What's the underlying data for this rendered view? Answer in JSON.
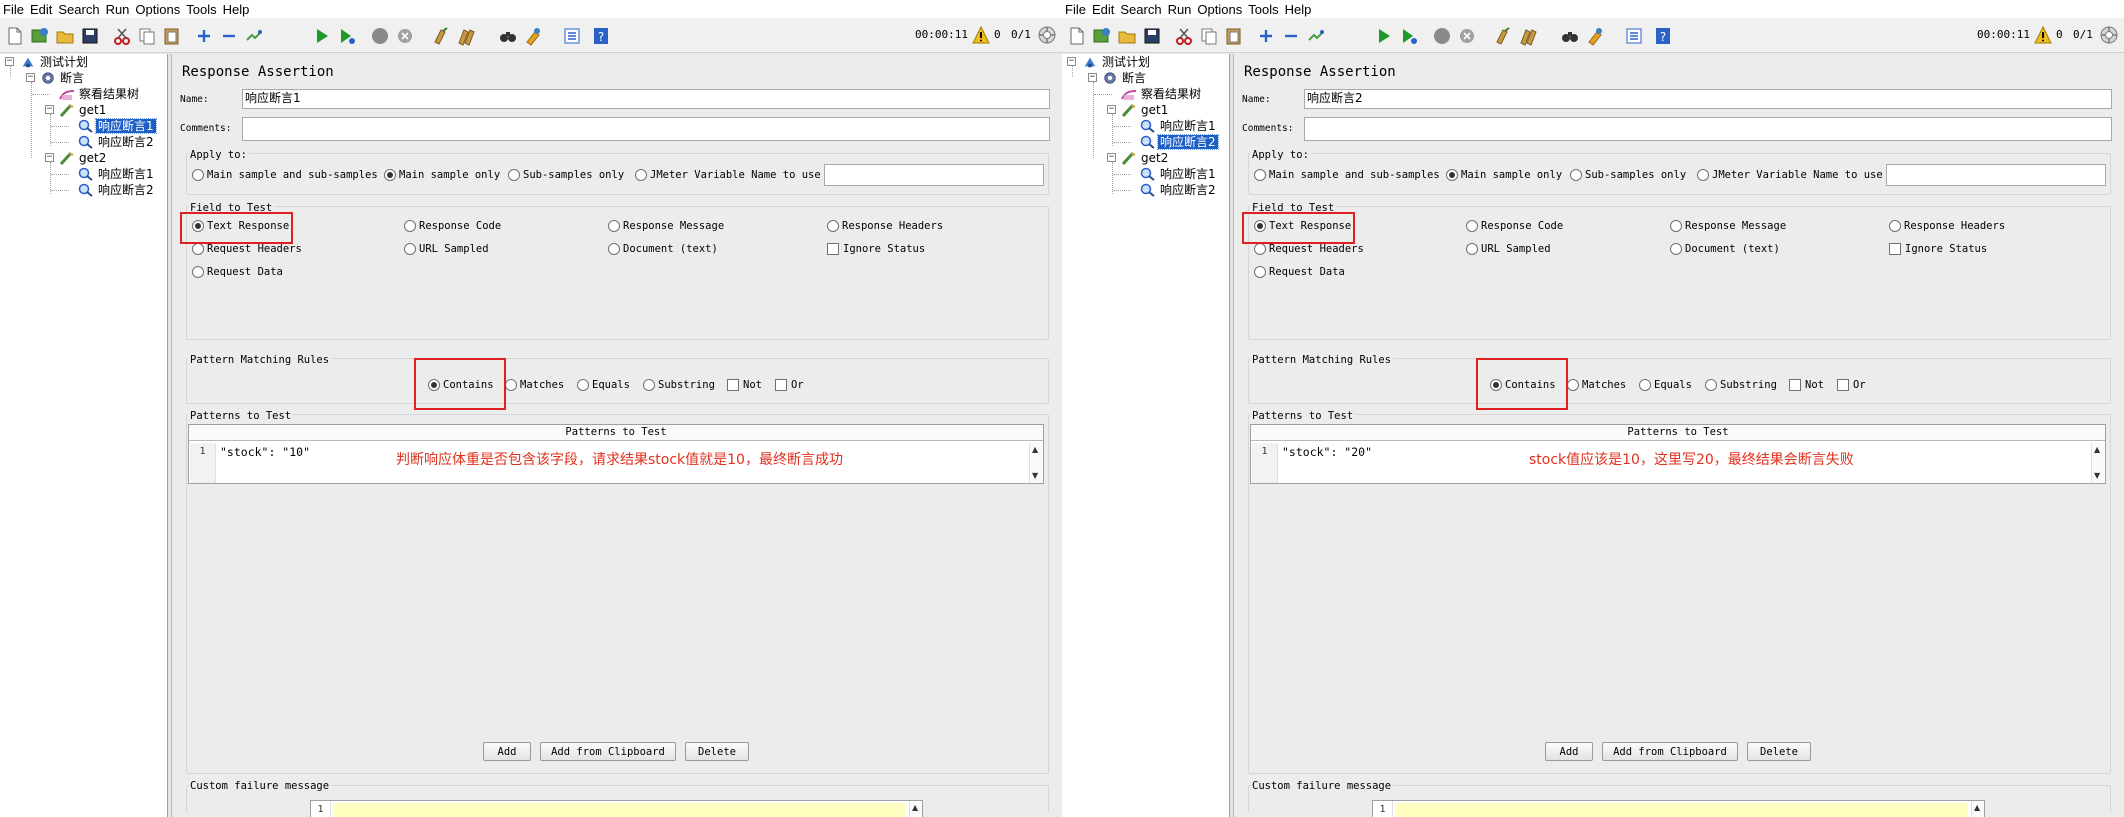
{
  "menu": [
    "File",
    "Edit",
    "Search",
    "Run",
    "Options",
    "Tools",
    "Help"
  ],
  "toolbar": {
    "timer": "00:00:11",
    "warn_count": "0",
    "thread_count": "0/1",
    "icons": [
      "new-icon",
      "templates-icon",
      "open-icon",
      "save-icon",
      "cut-icon",
      "copy-icon",
      "paste-icon",
      "expand-icon",
      "collapse-icon",
      "toggle-icon",
      "start-icon",
      "start-no-pause-icon",
      "stop-icon",
      "shutdown-icon",
      "clear-icon",
      "clear-all-icon",
      "search-icon",
      "reset-search-icon",
      "function-helper-icon",
      "help-icon"
    ]
  },
  "colors": {
    "annotation": "#e0301e",
    "selection": "#1c5ec4",
    "highlight": "#ffffc0"
  },
  "windows": [
    {
      "tree": {
        "plan": "测试计划",
        "group": "断言",
        "listener": "察看结果树",
        "get1": "get1",
        "get1_a1": "响应断言1",
        "get1_a2": "响应断言2",
        "get2": "get2",
        "get2_a1": "响应断言1",
        "get2_a2": "响应断言2",
        "selected": "get1_a1"
      },
      "form": {
        "title": "Response Assertion",
        "name_label": "Name:",
        "name_value": "响应断言1",
        "comments_label": "Comments:",
        "comments_value": "",
        "apply_to_label": "Apply to:",
        "apply_options": [
          "Main sample and sub-samples",
          "Main sample only",
          "Sub-samples only",
          "JMeter Variable Name to use"
        ],
        "apply_selected": 1,
        "jmeter_var_value": "",
        "field_label": "Field to Test",
        "fields": [
          "Text Response",
          "Response Code",
          "Response Message",
          "Response Headers",
          "Request Headers",
          "URL Sampled",
          "Document (text)",
          "Request Data"
        ],
        "field_selected": 0,
        "ignore_status": "Ignore Status",
        "pmr_label": "Pattern Matching Rules",
        "rules": [
          "Contains",
          "Matches",
          "Equals",
          "Substring"
        ],
        "rule_selected": 0,
        "not_label": "Not",
        "or_label": "Or",
        "patterns_label": "Patterns to Test",
        "patterns_header": "Patterns to Test",
        "pattern_line_no": "1",
        "pattern": "\"stock\": \"10\"",
        "annotation": "判断响应体重是否包含该字段，请求结果stock值就是10，最终断言成功",
        "add": "Add",
        "add_clipboard": "Add from Clipboard",
        "delete": "Delete",
        "failure_label": "Custom failure message",
        "failure_line_no": "1",
        "failure_value": ""
      }
    },
    {
      "tree": {
        "plan": "测试计划",
        "group": "断言",
        "listener": "察看结果树",
        "get1": "get1",
        "get1_a1": "响应断言1",
        "get1_a2": "响应断言2",
        "get2": "get2",
        "get2_a1": "响应断言1",
        "get2_a2": "响应断言2",
        "selected": "get1_a2"
      },
      "form": {
        "title": "Response Assertion",
        "name_label": "Name:",
        "name_value": "响应断言2",
        "comments_label": "Comments:",
        "comments_value": "",
        "apply_to_label": "Apply to:",
        "apply_options": [
          "Main sample and sub-samples",
          "Main sample only",
          "Sub-samples only",
          "JMeter Variable Name to use"
        ],
        "apply_selected": 1,
        "jmeter_var_value": "",
        "field_label": "Field to Test",
        "fields": [
          "Text Response",
          "Response Code",
          "Response Message",
          "Response Headers",
          "Request Headers",
          "URL Sampled",
          "Document (text)",
          "Request Data"
        ],
        "field_selected": 0,
        "ignore_status": "Ignore Status",
        "pmr_label": "Pattern Matching Rules",
        "rules": [
          "Contains",
          "Matches",
          "Equals",
          "Substring"
        ],
        "rule_selected": 0,
        "not_label": "Not",
        "or_label": "Or",
        "patterns_label": "Patterns to Test",
        "patterns_header": "Patterns to Test",
        "pattern_line_no": "1",
        "pattern": "\"stock\": \"20\"",
        "annotation": "stock值应该是10，这里写20，最终结果会断言失败",
        "add": "Add",
        "add_clipboard": "Add from Clipboard",
        "delete": "Delete",
        "failure_label": "Custom failure message",
        "failure_line_no": "1",
        "failure_value": ""
      }
    }
  ]
}
